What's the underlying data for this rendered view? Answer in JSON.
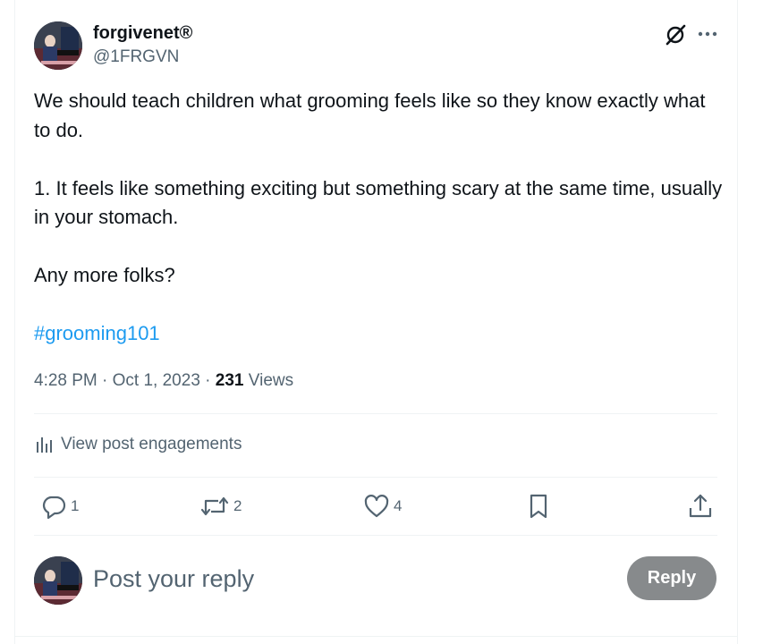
{
  "post": {
    "display_name": "forgivenet®",
    "handle": "@1FRGVN",
    "text": "We should teach children what grooming feels like so they know exactly what to do.\n\n1. It feels like something exciting but something scary at the same time, usually in your stomach.\n\nAny more folks?\n\n",
    "hashtag": "#grooming101",
    "time": "4:28 PM",
    "date": "Oct 1, 2023",
    "separator": " · ",
    "views_count": "231",
    "views_label": "Views"
  },
  "engagements": {
    "label": "View post engagements"
  },
  "actions": {
    "replies": "1",
    "reposts": "2",
    "likes": "4"
  },
  "reply_box": {
    "placeholder": "Post your reply",
    "button_label": "Reply"
  },
  "colors": {
    "accent": "#1d9bf0",
    "secondary_text": "#536471",
    "primary_text": "#0f1419",
    "disabled_button": "#878a8c",
    "divider": "#eff3f4"
  },
  "icons": {
    "grok": "grok-icon",
    "more": "more-icon",
    "analytics": "analytics-icon",
    "reply": "reply-icon",
    "repost": "repost-icon",
    "like": "heart-icon",
    "bookmark": "bookmark-icon",
    "share": "share-icon"
  }
}
